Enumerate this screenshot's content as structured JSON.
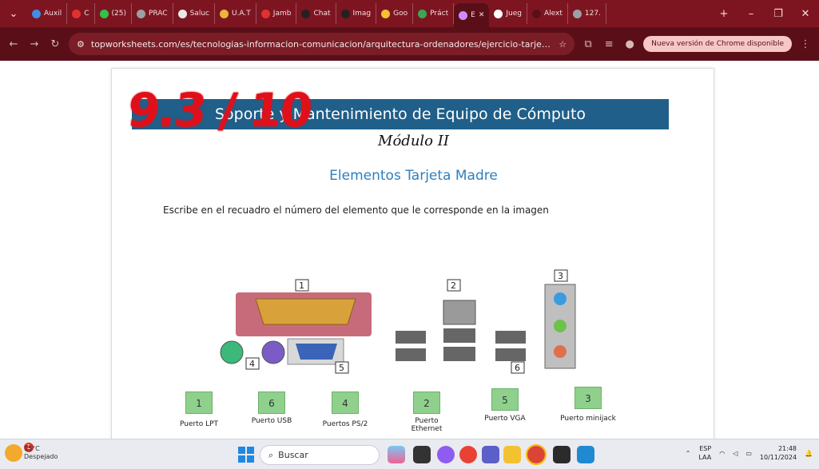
{
  "browser": {
    "tabs": [
      {
        "label": "Auxil",
        "color": "#3f8ee8"
      },
      {
        "label": "C",
        "color": "#e03131"
      },
      {
        "label": "(25)",
        "color": "#31c24a"
      },
      {
        "label": "PRAC",
        "color": "#9aa0a6"
      },
      {
        "label": "Saluc",
        "color": "#e8e8e8"
      },
      {
        "label": "U.A.T",
        "color": "#e8b63a"
      },
      {
        "label": "Jamb",
        "color": "#e03131"
      },
      {
        "label": "Chat",
        "color": "#222222"
      },
      {
        "label": "Imag",
        "color": "#222222"
      },
      {
        "label": "Goo",
        "color": "#f1c232"
      },
      {
        "label": "Práct",
        "color": "#3aa757"
      },
      {
        "label": "E",
        "color": "#d08cff"
      },
      {
        "label": "Jueg",
        "color": "#ffffff"
      },
      {
        "label": "Alext",
        "color": "#5a0f18"
      },
      {
        "label": "127.",
        "color": "#9aa0a6"
      }
    ],
    "url": "topworksheets.com/es/tecnologias-informacion-comunicacion/arquitectura-ordenadores/ejercicio-tarjeta-madre-614a83117...",
    "update_label": "Nueva versión de Chrome disponible"
  },
  "worksheet": {
    "score": "9.3 / 10",
    "banner": "Soporte y Mantenimiento de Equipo de Cómputo",
    "module": "Módulo II",
    "subtitle": "Elementos Tarjeta Madre",
    "instruction": "Escribe en el recuadro el número del elemento que le corresponde en la imagen",
    "board_labels": [
      "1",
      "2",
      "3",
      "4",
      "5",
      "6"
    ],
    "answers": [
      {
        "value": "1",
        "label": "Puerto LPT"
      },
      {
        "value": "6",
        "label": "Puerto USB"
      },
      {
        "value": "4",
        "label": "Puertos PS/2"
      },
      {
        "value": "2",
        "label": "Puerto Ethernet"
      },
      {
        "value": "5",
        "label": "Puerto VGA"
      },
      {
        "value": "3",
        "label": "Puerto minijack"
      }
    ]
  },
  "taskbar": {
    "weather_badge": "1",
    "temperature": "15°C",
    "weather": "Despejado",
    "search_placeholder": "Buscar",
    "lang": "ESP",
    "layout": "LAA",
    "time": "21:48",
    "date": "10/11/2024"
  }
}
